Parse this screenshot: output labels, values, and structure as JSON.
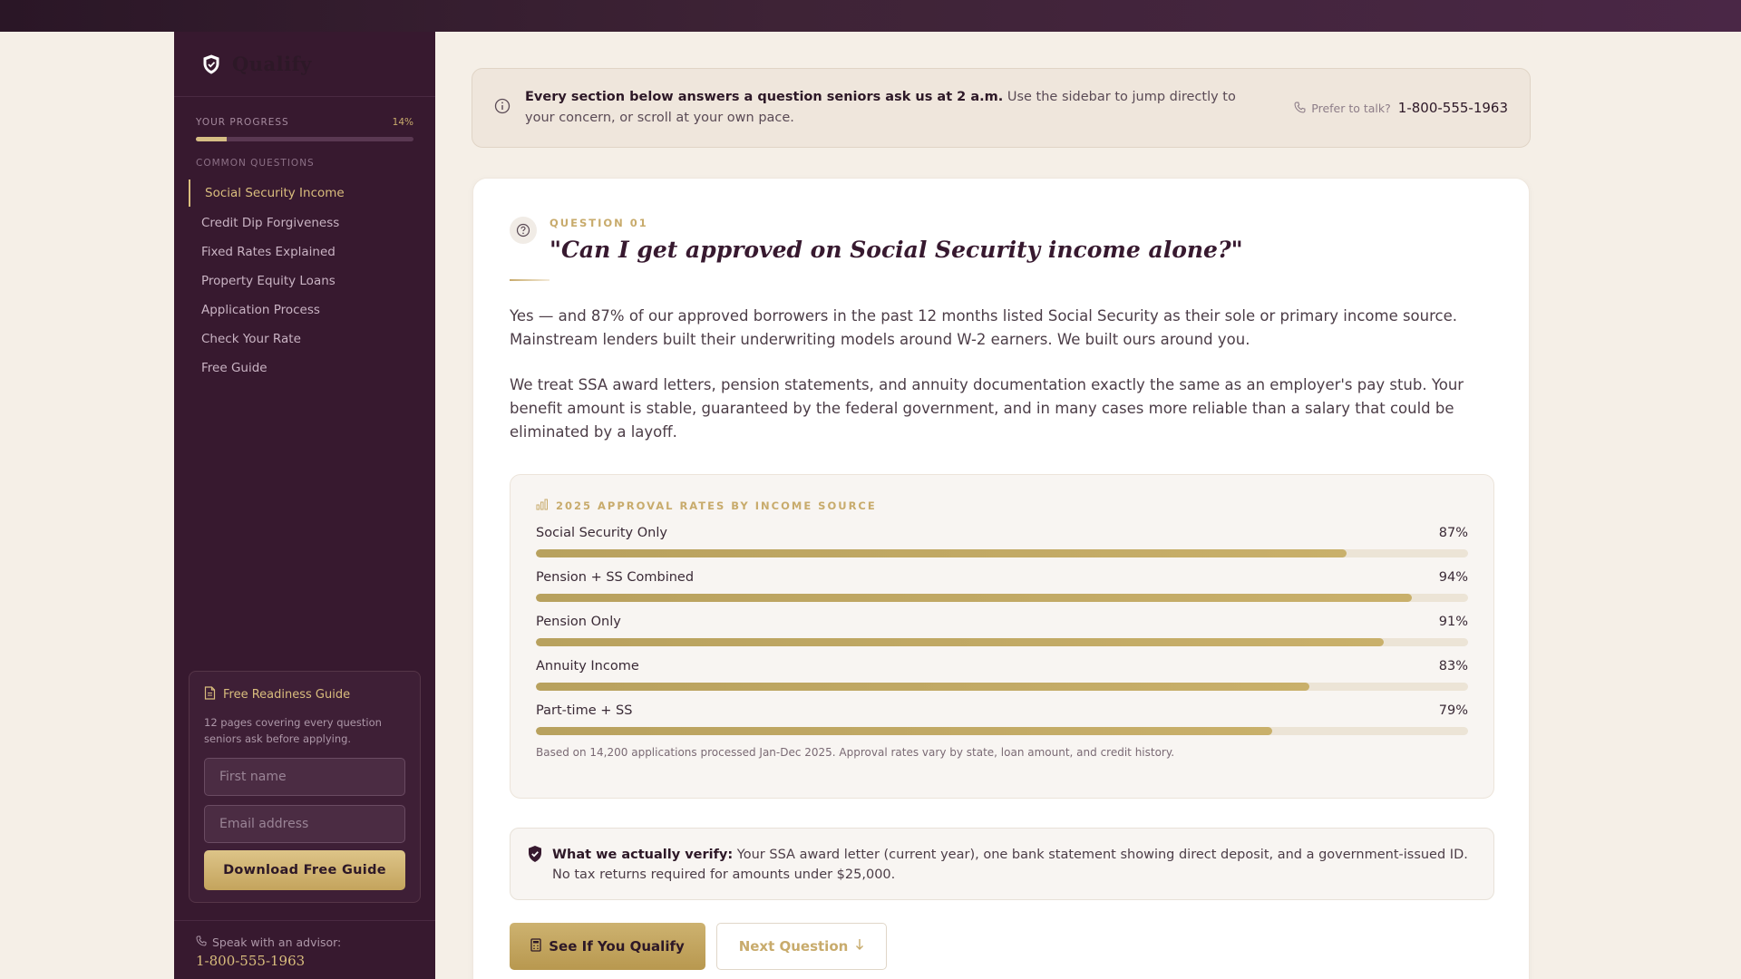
{
  "app": {
    "name": "Qualify"
  },
  "sidebar": {
    "progress_label": "YOUR PROGRESS",
    "progress_pct_text": "14%",
    "progress_value": 0.14,
    "section_label": "COMMON QUESTIONS",
    "items": [
      {
        "label": "Social Security Income",
        "active": true
      },
      {
        "label": "Credit Dip Forgiveness"
      },
      {
        "label": "Fixed Rates Explained"
      },
      {
        "label": "Property Equity Loans"
      },
      {
        "label": "Application Process"
      },
      {
        "label": "Check Your Rate"
      },
      {
        "label": "Free Guide"
      }
    ],
    "guide": {
      "title": "Free Readiness Guide",
      "description": "12 pages covering every question seniors ask before applying.",
      "first_name_placeholder": "First name",
      "email_placeholder": "Email address",
      "button": "Download Free Guide"
    },
    "advisor": {
      "label": "Speak with an advisor:",
      "phone": "1-800-555-1963"
    }
  },
  "banner": {
    "bold": "Every section below answers a question seniors ask us at 2 a.m.",
    "text": "Use the sidebar to jump directly to your concern, or scroll at your own pace.",
    "prefer": "Prefer to talk?",
    "phone": "1-800-555-1963"
  },
  "question": {
    "label": "QUESTION 01",
    "title": "\"Can I get approved on Social Security income alone?\"",
    "para1": "Yes — and 87% of our approved borrowers in the past 12 months listed Social Security as their sole or primary income source. Mainstream lenders built their underwriting models around W-2 earners. We built ours around you.",
    "para2": "We treat SSA award letters, pension statements, and annuity documentation exactly the same as an employer's pay stub. Your benefit amount is stable, guaranteed by the federal government, and in many cases more reliable than a salary that could be eliminated by a layoff."
  },
  "rates": {
    "title": "2025 APPROVAL RATES BY INCOME SOURCE",
    "rows": [
      {
        "label": "Social Security Only",
        "pct_text": "87%",
        "value": 87
      },
      {
        "label": "Pension + SS Combined",
        "pct_text": "94%",
        "value": 94
      },
      {
        "label": "Pension Only",
        "pct_text": "91%",
        "value": 91
      },
      {
        "label": "Annuity Income",
        "pct_text": "83%",
        "value": 83
      },
      {
        "label": "Part-time + SS",
        "pct_text": "79%",
        "value": 79
      }
    ],
    "note": "Based on 14,200 applications processed Jan-Dec 2025. Approval rates vary by state, loan amount, and credit history."
  },
  "verify": {
    "bold": "What we actually verify:",
    "text": "Your SSA award letter (current year), one bank statement showing direct deposit, and a government-issued ID. No tax returns required for amounts under $25,000."
  },
  "actions": {
    "primary": "See If You Qualify",
    "secondary": "Next Question"
  },
  "colors": {
    "accent_gold": "#c8ab6c",
    "sidebar_bg": "#37192f",
    "page_bg": "#f5efe7"
  }
}
